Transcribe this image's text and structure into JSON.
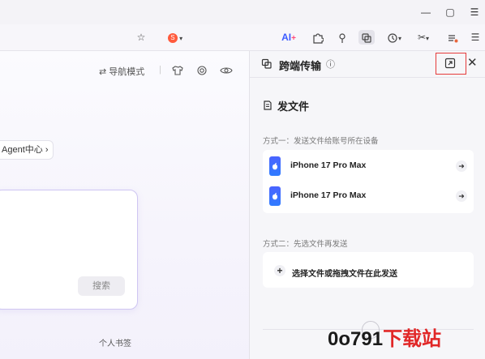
{
  "toolbar": {
    "ai_label": "AI",
    "ai_plus": "+"
  },
  "page": {
    "nav_mode_label": "导航模式",
    "agent_chip_label": "Agent中心",
    "search_button_label": "搜索",
    "bookmark_label": "个人书签"
  },
  "panel": {
    "title": "跨端传输",
    "section_title": "发文件",
    "mode_one_label": "方式一：发送文件给账号所在设备",
    "devices": [
      {
        "name": "iPhone 17 Pro Max"
      },
      {
        "name": "iPhone 17 Pro Max"
      }
    ],
    "mode_two_label": "方式二：先选文件再发送",
    "choose_file_label": "选择文件或拖拽文件在此发送"
  },
  "watermark": {
    "part1": "0o791",
    "part2": "下载站"
  },
  "colors": {
    "accent": "#3b5bff",
    "highlight": "#e53b3b",
    "input_border": "#cfc6f2"
  }
}
